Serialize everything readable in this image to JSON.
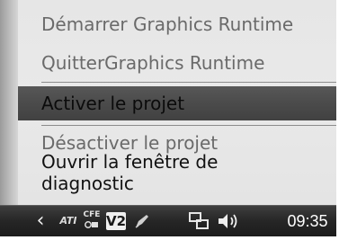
{
  "menu": {
    "items": [
      {
        "label": "Démarrer Graphics Runtime",
        "state": "disabled"
      },
      {
        "label": "QuitterGraphics Runtime",
        "state": "disabled"
      },
      {
        "label": "Activer le projet",
        "state": "highlighted"
      },
      {
        "label": "Désactiver le projet",
        "state": "disabled"
      },
      {
        "label_line1": "Ouvrir la fenêtre de",
        "label_line2": "diagnostic",
        "state": "enabled"
      }
    ]
  },
  "taskbar": {
    "chevron": "‹",
    "ati_label": "ATI",
    "cfg_label": "CFE",
    "v2_label": "V2",
    "clock": "09:35",
    "icons": [
      "show-hidden-icons",
      "ati-catalyst-icon",
      "configuration-icon",
      "v2-runtime-icon",
      "pen-icon",
      "network-icon",
      "volume-icon"
    ]
  },
  "colors": {
    "menu_background": "#e7e7e7",
    "highlight": "#4b4b4b",
    "disabled_text": "#6a6a6a",
    "taskbar": "#262626"
  }
}
